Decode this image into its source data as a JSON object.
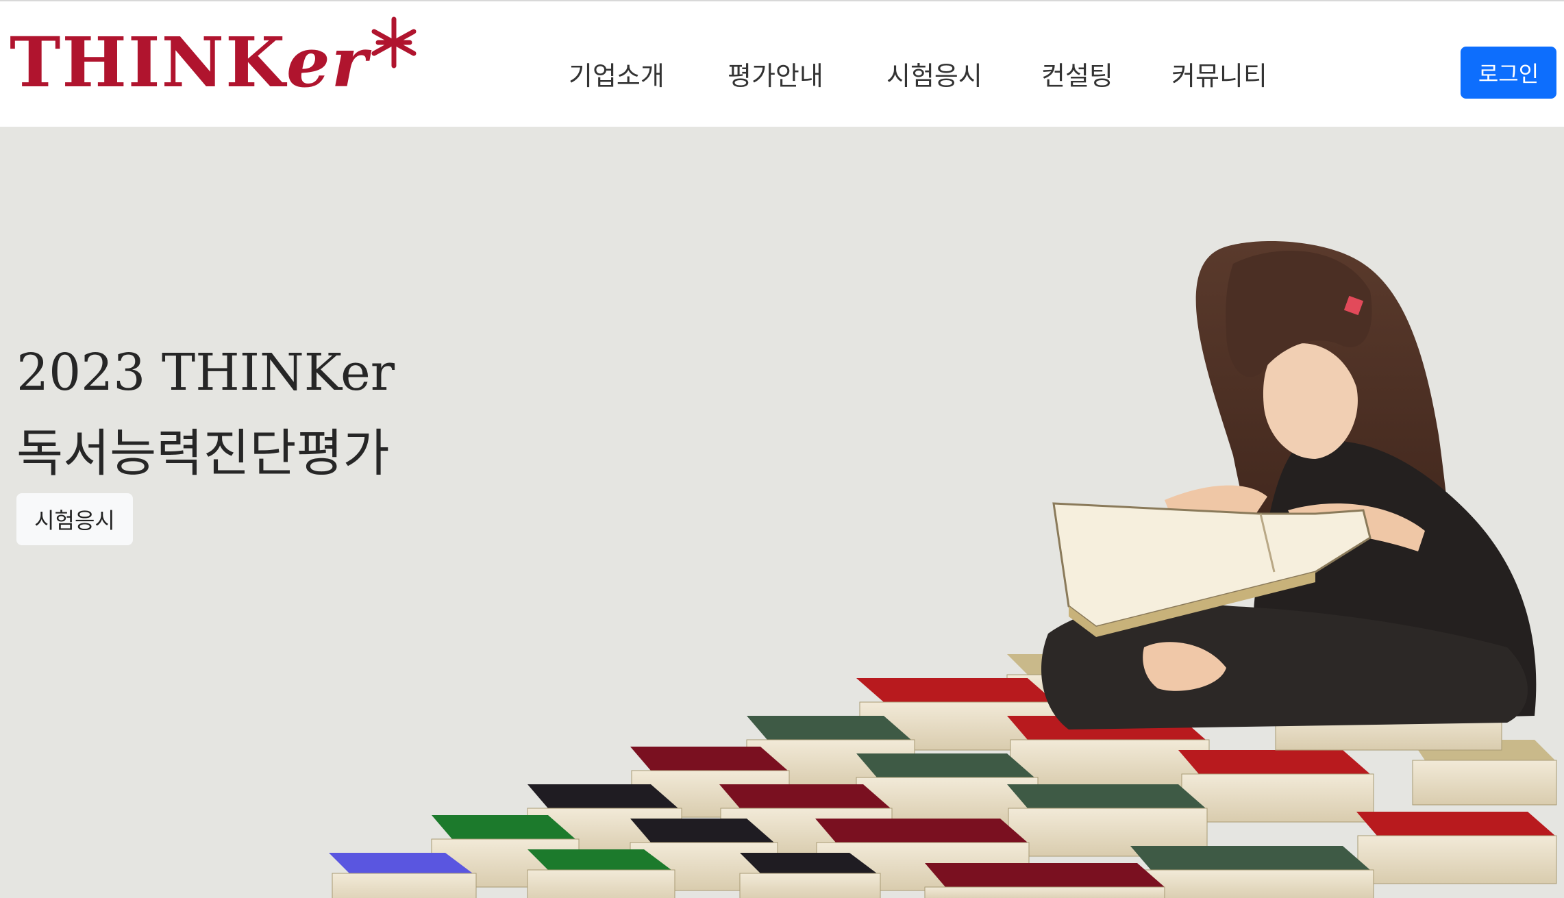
{
  "brand": {
    "logo_text": "THINKer",
    "color": "#b0142e"
  },
  "nav": {
    "items": [
      {
        "label": "기업소개"
      },
      {
        "label": "평가안내"
      },
      {
        "label": "시험응시"
      },
      {
        "label": "컨설팅"
      },
      {
        "label": "커뮤니티"
      }
    ],
    "login_label": "로그인",
    "login_color": "#0d6efd"
  },
  "hero": {
    "title_line1": "2023 THINKer",
    "title_line2": "독서능력진단평가",
    "cta_label": "시험응시",
    "background": "#e5e5e1"
  }
}
